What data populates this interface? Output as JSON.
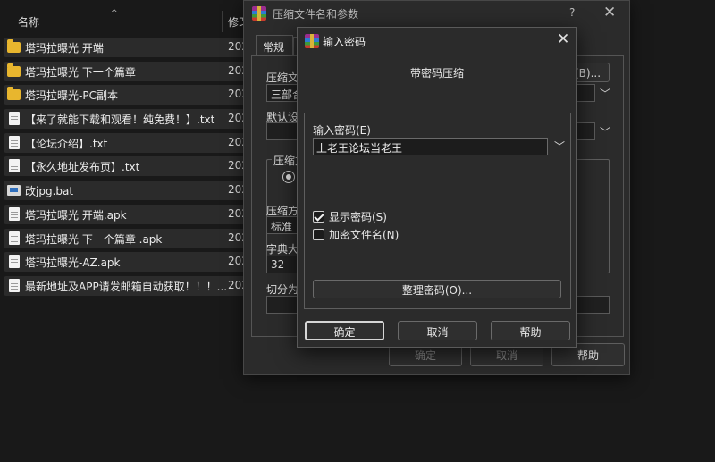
{
  "explorer": {
    "column_name": "名称",
    "sort_indicator": "^",
    "column_modified": "修改",
    "files": [
      {
        "name": "塔玛拉曝光 开端",
        "type": "folder",
        "date": "202"
      },
      {
        "name": "塔玛拉曝光 下一个篇章",
        "type": "folder",
        "date": "202"
      },
      {
        "name": "塔玛拉曝光-PC副本",
        "type": "folder",
        "date": "202"
      },
      {
        "name": "【来了就能下载和观看！纯免费！】.txt",
        "type": "doc",
        "date": "202"
      },
      {
        "name": "【论坛介绍】.txt",
        "type": "doc",
        "date": "202"
      },
      {
        "name": "【永久地址发布页】.txt",
        "type": "doc",
        "date": "202"
      },
      {
        "name": "改jpg.bat",
        "type": "bat",
        "date": "202"
      },
      {
        "name": "塔玛拉曝光 开端.apk",
        "type": "doc",
        "date": "202"
      },
      {
        "name": "塔玛拉曝光 下一个篇章 .apk",
        "type": "doc",
        "date": "202"
      },
      {
        "name": "塔玛拉曝光-AZ.apk",
        "type": "doc",
        "date": "202"
      },
      {
        "name": "最新地址及APP请发邮箱自动获取！！！...",
        "type": "doc",
        "date": "202"
      }
    ]
  },
  "params_dialog": {
    "title": "压缩文件名和参数",
    "help_glyph": "?",
    "close_glyph": "✕",
    "tab_general": "常规",
    "label_archive_name": "压缩文",
    "archive_name_value": "三部合",
    "browse_button": "(B)...",
    "label_default_settings": "默认设",
    "label_format": "压缩文",
    "label_method": "压缩方",
    "method_value": "标准",
    "label_dict": "字典大",
    "dict_value": "32",
    "label_split": "切分为",
    "ok_button": "确定",
    "cancel_button": "取消",
    "help_button": "帮助"
  },
  "password_dialog": {
    "title": "输入密码",
    "close_glyph": "✕",
    "heading": "带密码压缩",
    "label_enter_password": "输入密码(E)",
    "password_value": "上老王论坛当老王",
    "show_password_label": "显示密码(S)",
    "show_password_checked": true,
    "encrypt_names_label": "加密文件名(N)",
    "encrypt_names_checked": false,
    "organize_button": "整理密码(O)...",
    "ok_button": "确定",
    "cancel_button": "取消",
    "help_button": "帮助"
  },
  "colors": {
    "background": "#191919",
    "dialog": "#2b2b2b",
    "folder": "#e8b62e",
    "text": "#e8e8e8"
  }
}
